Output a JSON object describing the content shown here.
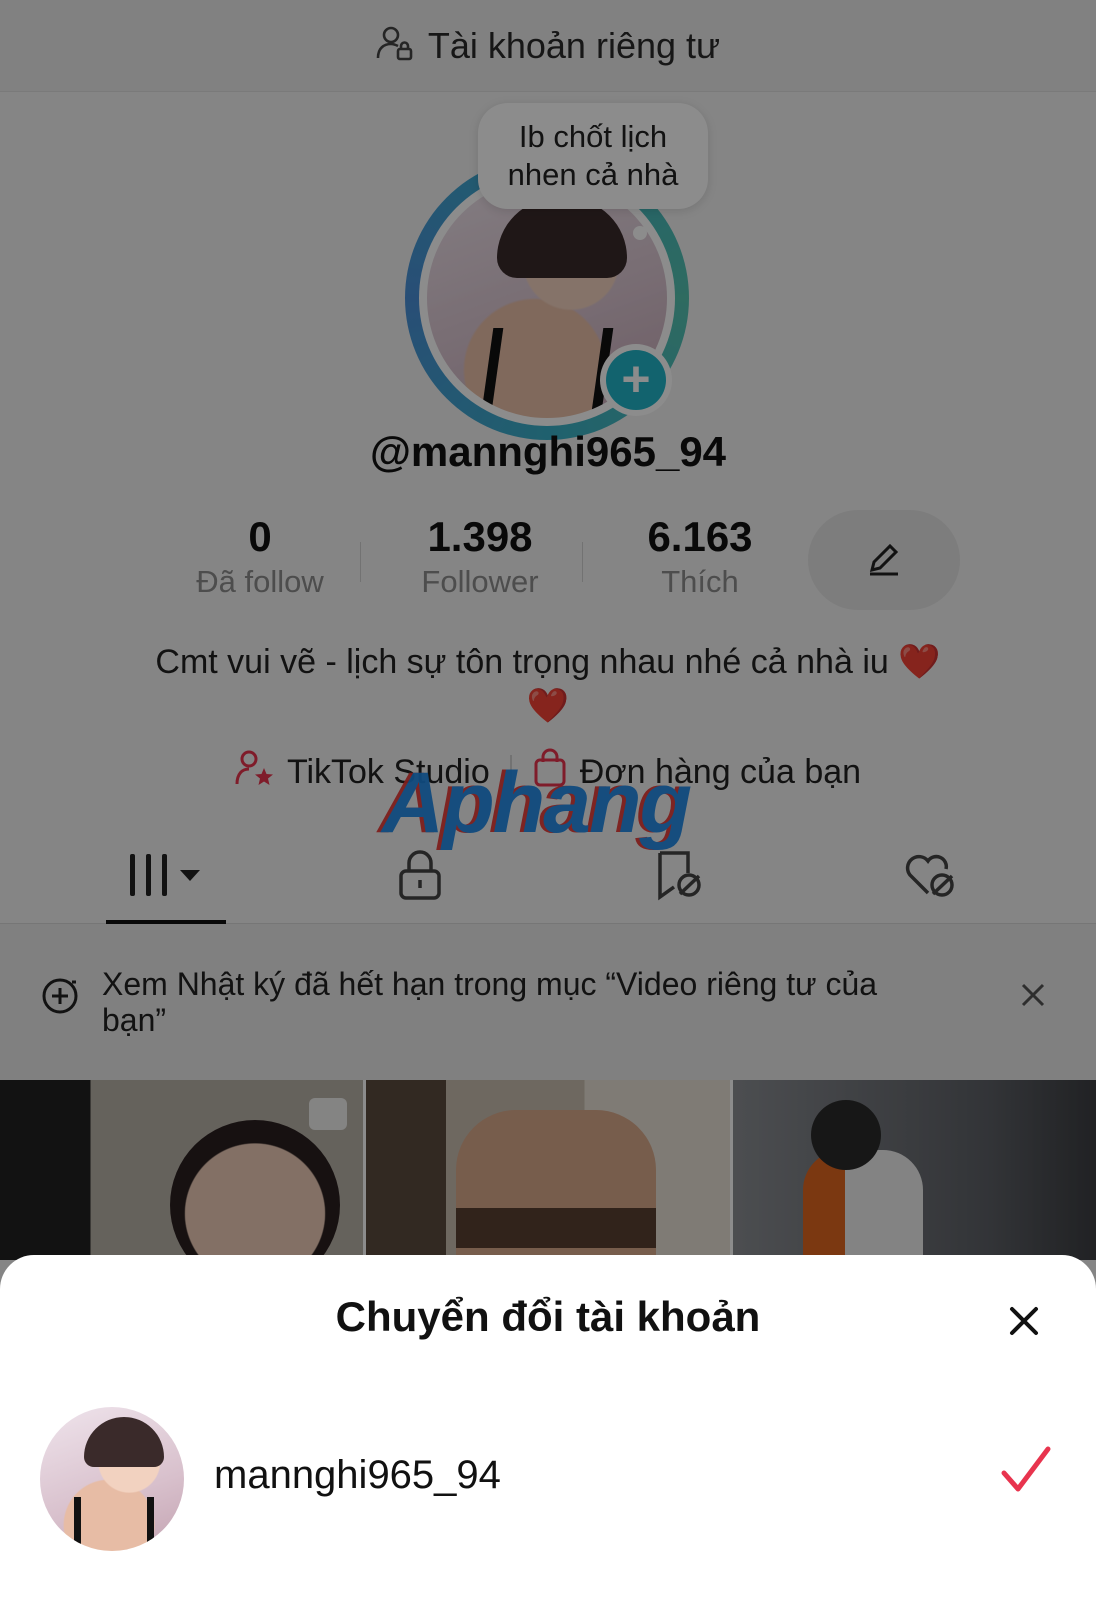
{
  "header": {
    "title": "Tài khoản riêng tư",
    "icon": "private-account-icon"
  },
  "profile": {
    "note_bubble": "Ib chốt lịch nhen cả nhà",
    "username": "@mannghi965_94",
    "stats": [
      {
        "value": "0",
        "label": "Đã follow"
      },
      {
        "value": "1.398",
        "label": "Follower"
      },
      {
        "value": "6.163",
        "label": "Thích"
      }
    ],
    "edit_icon": "pencil-icon",
    "bio": "Cmt vui vẽ - lịch sự tôn trọng nhau nhé cả nhà iu",
    "bio_emoji": "❤️",
    "links": [
      {
        "label": "TikTok Studio",
        "icon": "creator-star-icon"
      },
      {
        "label": "Đơn hàng của bạn",
        "icon": "shopping-bag-icon"
      }
    ],
    "watermark": "Aphang"
  },
  "tabs": [
    {
      "name": "videos",
      "icon": "grid-videos-icon",
      "active": true
    },
    {
      "name": "private",
      "icon": "lock-icon",
      "active": false
    },
    {
      "name": "favorites-hidden",
      "icon": "bookmark-hidden-icon",
      "active": false
    },
    {
      "name": "liked-hidden",
      "icon": "heart-hidden-icon",
      "active": false
    }
  ],
  "notice": {
    "text": "Xem Nhật ký đã hết hạn trong mục “Video riêng tư của bạn”",
    "icon": "story-add-icon"
  },
  "sheet": {
    "title": "Chuyển đổi tài khoản",
    "accounts": [
      {
        "name": "mannghi965_94",
        "selected": true
      }
    ]
  },
  "colors": {
    "accent": "#22b5c9",
    "check": "#e8344e",
    "heart": "#e02424"
  }
}
